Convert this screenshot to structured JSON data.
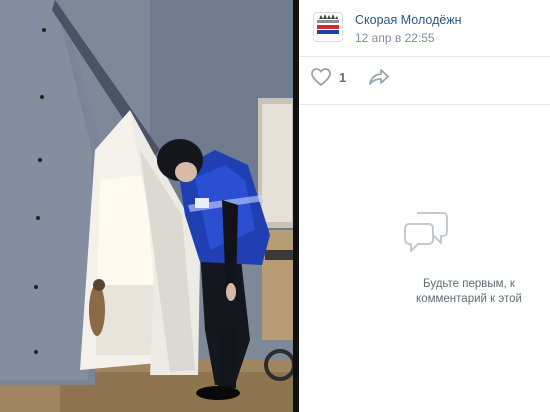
{
  "post": {
    "author": "Скорая Молодёжн",
    "date": "12 апр в 22:55"
  },
  "actions": {
    "like_count": "1"
  },
  "comments": {
    "empty_line1": "Будьте первым, к",
    "empty_line2": "комментарий к этой"
  },
  "colors": {
    "link": "#2a5885",
    "muted": "#818c99",
    "icon": "#99a2ad",
    "vest_blue": "#1f3fb3"
  }
}
